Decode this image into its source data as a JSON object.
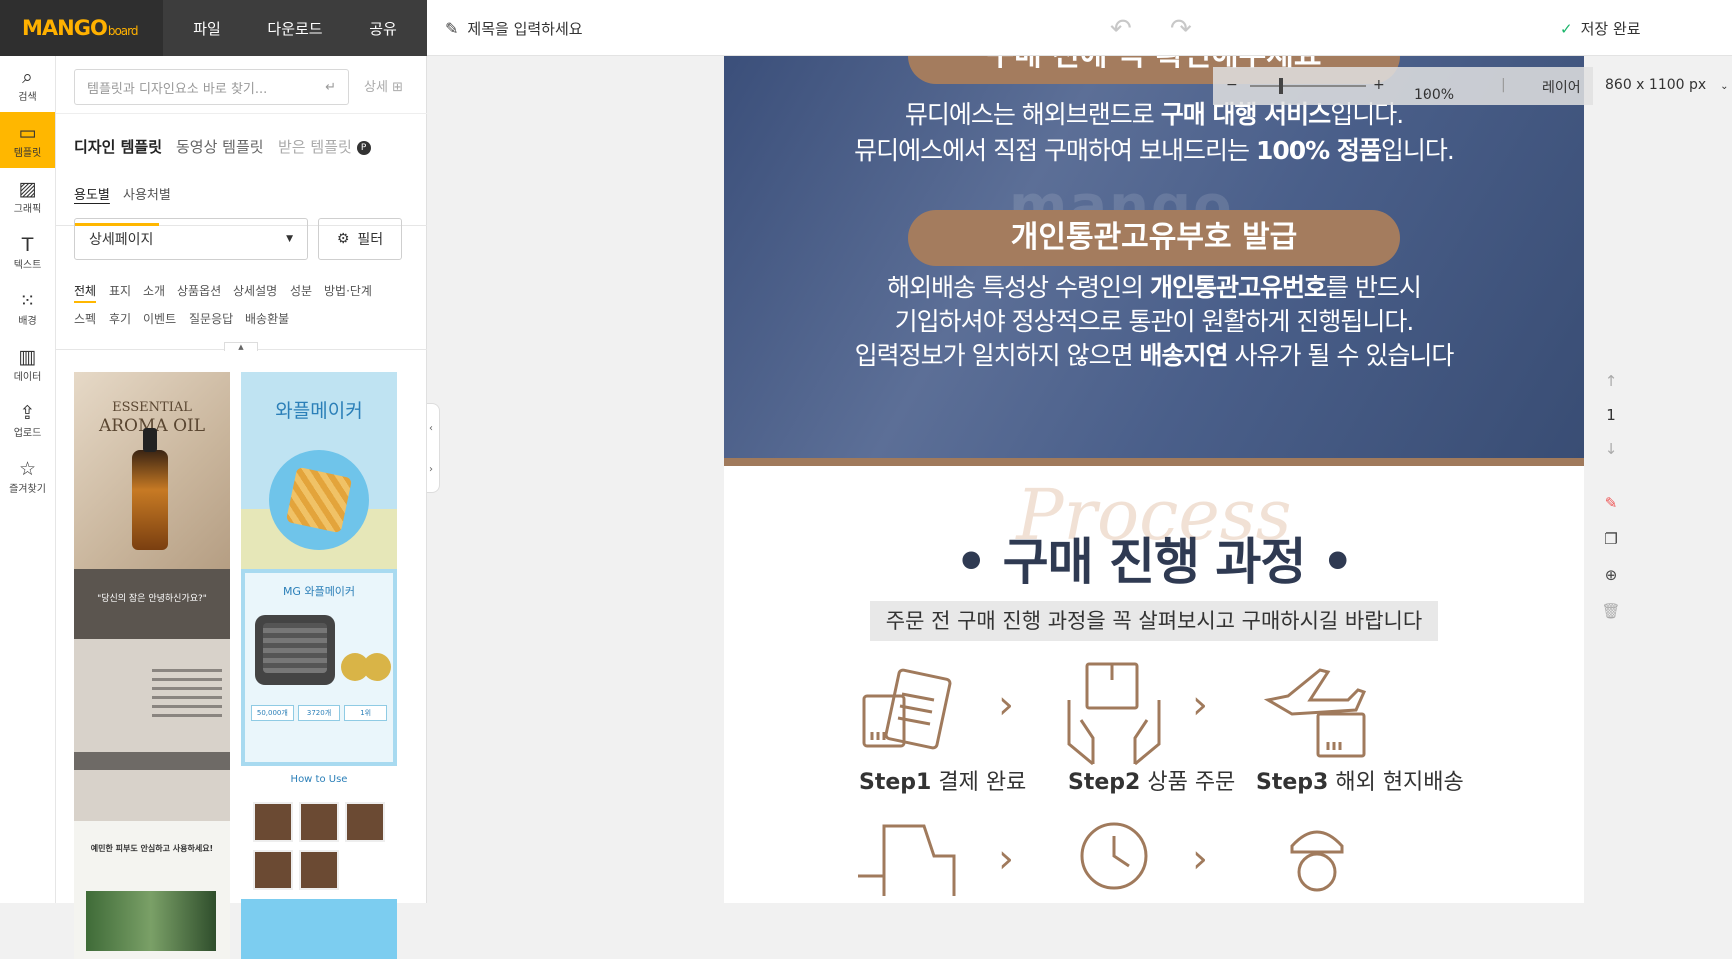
{
  "header": {
    "logo_main": "MANGO",
    "logo_sub": "board",
    "menu": [
      "파일",
      "다운로드",
      "공유"
    ],
    "title_placeholder": "제목을 입력하세요",
    "save_status": "저장 완료"
  },
  "rail": [
    {
      "label": "검색",
      "icon": "search-icon"
    },
    {
      "label": "템플릿",
      "icon": "template-icon"
    },
    {
      "label": "그래픽",
      "icon": "graphic-icon"
    },
    {
      "label": "텍스트",
      "icon": "text-icon"
    },
    {
      "label": "배경",
      "icon": "background-icon"
    },
    {
      "label": "데이터",
      "icon": "chart-icon"
    },
    {
      "label": "업로드",
      "icon": "upload-icon"
    },
    {
      "label": "즐겨찾기",
      "icon": "star-icon"
    }
  ],
  "panel": {
    "search_placeholder": "템플릿과 디자인요소 바로 찾기...",
    "detail_label": "상세",
    "tabs": [
      "디자인 템플릿",
      "동영상 템플릿",
      "받은 템플릿"
    ],
    "premium_badge": "P",
    "subtabs": [
      "용도별",
      "사용처별"
    ],
    "select_value": "상세페이지",
    "filter_label": "필터",
    "categories_row1": [
      "전체",
      "표지",
      "소개",
      "상품옵션",
      "상세설명",
      "성분",
      "방법·단계"
    ],
    "categories_row2": [
      "스펙",
      "후기",
      "이벤트",
      "질문응답",
      "배송환불"
    ],
    "thumbs": {
      "aroma_small": "ESSENTIAL",
      "aroma_big": "AROMA OIL",
      "sleep_text": "\"당신의 잠은 안녕하신가요?\"",
      "skin_text": "예민한 피부도 안심하고 사용하세요!",
      "waffle_title": "와플메이커",
      "waffle2_title": "MG 와플메이커",
      "stat1": "50,000개",
      "stat2": "3720개",
      "stat3": "1위",
      "howto": "How to Use"
    }
  },
  "canvas": {
    "pill_top": "구매 전에 꼭 확인해주세요",
    "line1_a": "뮤디에스는 해외브랜드로 ",
    "line1_b": "구매 대행 서비스",
    "line1_c": "입니다.",
    "line2_a": "뮤디에스에서 직접 구매하여 보내드리는 ",
    "line2_b": "100% 정품",
    "line2_c": "입니다.",
    "pill_mid": "개인통관고유부호 발급",
    "line3_a": "해외배송 특성상 수령인의 ",
    "line3_b": "개인통관고유번호",
    "line3_c": "를 반드시",
    "line4": "기입하셔야 정상적으로 통관이  원활하게 진행됩니다.",
    "line5_a": "입력정보가 일치하지 않으면  ",
    "line5_b": "배송지연",
    "line5_c": " 사유가 될 수 있습니다",
    "watermark": "mango",
    "process_script": "Process",
    "process_title": "• 구매 진행 과정 •",
    "process_sub": "주문 전 구매 진행 과정을 꼭 살펴보시고 구매하시길 바랍니다",
    "steps": [
      {
        "num": "Step1",
        "text": "결제 완료"
      },
      {
        "num": "Step2",
        "text": "상품 주문"
      },
      {
        "num": "Step3",
        "text": "해외 현지배송"
      }
    ]
  },
  "zoom": {
    "minus": "−",
    "plus": "+",
    "level": "100%",
    "layer": "레이어",
    "size": "860 x 1100 px"
  },
  "page_nav": {
    "current": "1"
  },
  "colors": {
    "accent": "#ffb700",
    "brown": "#a07a5c",
    "navy": "#2f3a52"
  }
}
